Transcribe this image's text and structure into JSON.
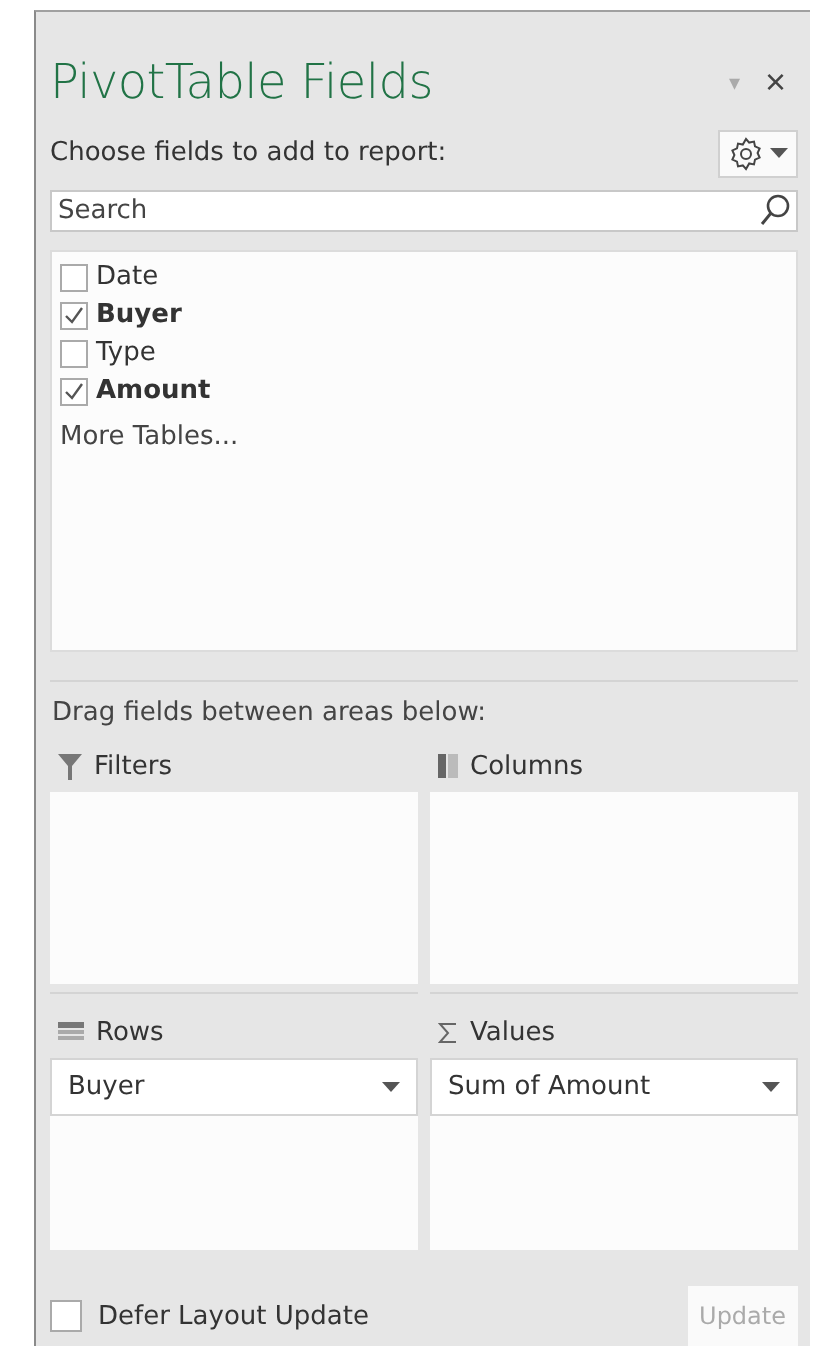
{
  "panel": {
    "title": "PivotTable Fields",
    "menu_arrow": "▾",
    "close": "×"
  },
  "prompt": "Choose fields to add to report:",
  "search": {
    "placeholder": "Search"
  },
  "fields": [
    {
      "label": "Date",
      "checked": false
    },
    {
      "label": "Buyer",
      "checked": true
    },
    {
      "label": "Type",
      "checked": false
    },
    {
      "label": "Amount",
      "checked": true
    }
  ],
  "more_tables": "More Tables...",
  "areas_label": "Drag fields between areas below:",
  "areas": [
    {
      "kind": "filters",
      "title": "Filters"
    },
    {
      "kind": "columns",
      "title": "Columns"
    },
    {
      "kind": "rows",
      "title": "Rows",
      "items": [
        "Buyer"
      ]
    },
    {
      "kind": "values",
      "title": "Values",
      "items": [
        "Sum of Amount"
      ]
    }
  ],
  "footer": {
    "defer_label": "Defer Layout Update",
    "defer_checked": false,
    "update": "Update",
    "update_disabled": true
  }
}
